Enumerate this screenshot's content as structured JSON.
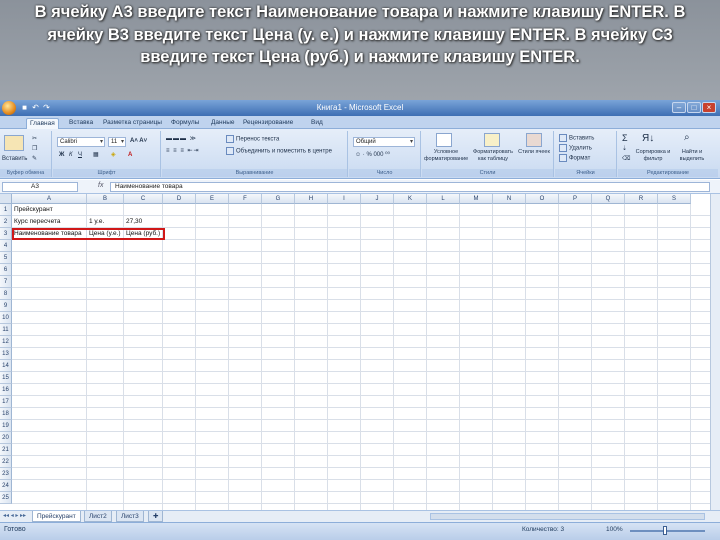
{
  "caption": "В ячейку А3 введите текст Наименование товара и нажмите клавишу ENTER. В ячейку В3 введите текст Цена (у. е.) и нажмите клавишу ENTER. В ячейку С3 введите текст Цена (руб.) и нажмите клавишу ENTER.",
  "window": {
    "title": "Книга1 - Microsoft Excel"
  },
  "tabs": [
    "Главная",
    "Вставка",
    "Разметка страницы",
    "Формулы",
    "Данные",
    "Рецензирование",
    "Вид"
  ],
  "ribbon": {
    "groups": {
      "clipboard": "Буфер обмена",
      "font": "Шрифт",
      "alignment": "Выравнивание",
      "number": "Число",
      "styles": "Стили",
      "cells": "Ячейки",
      "editing": "Редактирование"
    },
    "paste": "Вставить",
    "font_name": "Calibri",
    "font_size": "11",
    "wrap_text": "Перенос текста",
    "merge_center": "Объединить и поместить в центре",
    "number_format": "Общий",
    "conditional": "Условное форматирование",
    "format_table": "Форматировать как таблицу",
    "cell_styles": "Стили ячеек",
    "insert": "Вставить",
    "delete": "Удалить",
    "format": "Формат",
    "sort": "Сортировка и фильтр",
    "find": "Найти и выделить"
  },
  "formula_bar": {
    "name_box": "A3",
    "fx": "fx",
    "content": "Наименование товара"
  },
  "columns": [
    "A",
    "B",
    "C",
    "D",
    "E",
    "F",
    "G",
    "H",
    "I",
    "J",
    "K",
    "L",
    "M",
    "N",
    "O",
    "P",
    "Q",
    "R",
    "S"
  ],
  "rows": [
    "1",
    "2",
    "3",
    "4",
    "5",
    "6",
    "7",
    "8",
    "9",
    "10",
    "11",
    "12",
    "13",
    "14",
    "15",
    "16",
    "17",
    "18",
    "19",
    "20",
    "21",
    "22",
    "23",
    "24",
    "25"
  ],
  "cells": {
    "a1": "Прейскурант",
    "a2": "Курс пересчета",
    "b2": "1 у.е.",
    "c2": "27,30",
    "a3": "Наименование товара",
    "b3": "Цена (у.е.)",
    "c3": "Цена (руб.)"
  },
  "sheets": [
    "Прейскурант",
    "Лист2",
    "Лист3"
  ],
  "status": {
    "ready": "Готово",
    "count": "Количество: 3",
    "zoom": "100%"
  }
}
